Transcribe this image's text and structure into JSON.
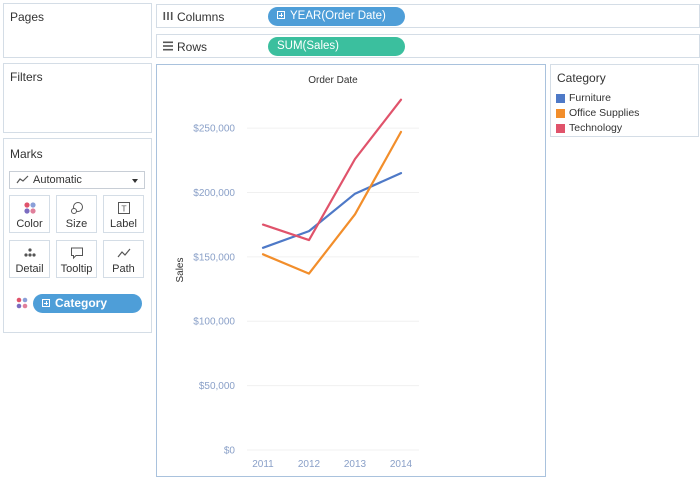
{
  "panels": {
    "pages_title": "Pages",
    "filters_title": "Filters",
    "marks_title": "Marks"
  },
  "shelves": {
    "columns_label": "Columns",
    "columns_pill": "YEAR(Order Date)",
    "rows_label": "Rows",
    "rows_pill": "SUM(Sales)"
  },
  "marks": {
    "mark_type": "Automatic",
    "buttons": [
      "Color",
      "Size",
      "Label",
      "Detail",
      "Tooltip",
      "Path"
    ],
    "color_field": "Category"
  },
  "legend": {
    "title": "Category",
    "items": [
      {
        "label": "Furniture",
        "color": "#4e79c7"
      },
      {
        "label": "Office Supplies",
        "color": "#f28e2b"
      },
      {
        "label": "Technology",
        "color": "#e0536b"
      }
    ]
  },
  "colors": {
    "columns_pill": "#4e9ed8",
    "rows_pill": "#3bbf9e",
    "category_pill": "#4e9ed8"
  },
  "chart_data": {
    "type": "line",
    "title": "Order Date",
    "xlabel": "",
    "ylabel": "Sales",
    "categories": [
      "2011",
      "2012",
      "2013",
      "2014"
    ],
    "ylim": [
      0,
      285000
    ],
    "yticks": [
      0,
      50000,
      100000,
      150000,
      200000,
      250000
    ],
    "ytick_labels": [
      "$0",
      "$50,000",
      "$100,000",
      "$150,000",
      "$200,000",
      "$250,000"
    ],
    "grid": "horizontal",
    "series": [
      {
        "name": "Furniture",
        "color": "#4e79c7",
        "values": [
          157000,
          170000,
          199000,
          215000
        ]
      },
      {
        "name": "Office Supplies",
        "color": "#f28e2b",
        "values": [
          152000,
          137000,
          183000,
          247000
        ]
      },
      {
        "name": "Technology",
        "color": "#e0536b",
        "values": [
          175000,
          163000,
          226000,
          272000
        ]
      }
    ]
  }
}
